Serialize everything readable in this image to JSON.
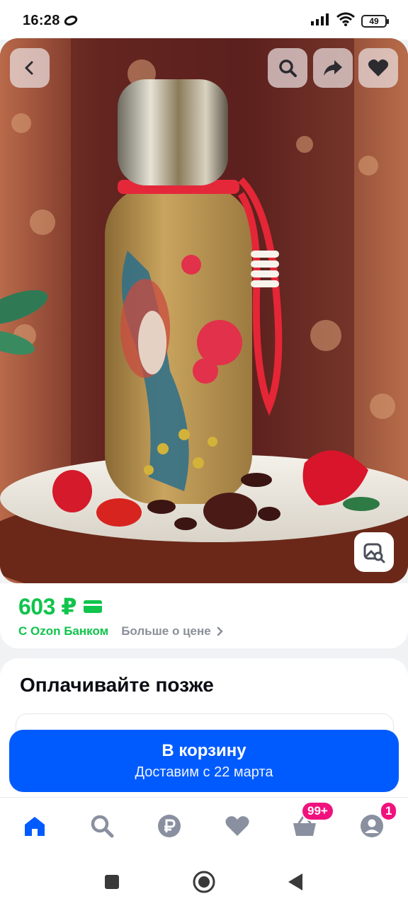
{
  "status_bar": {
    "time": "16:28",
    "battery": "49",
    "icons": [
      "moon-icon",
      "signal-icon",
      "wifi-icon",
      "battery-icon"
    ]
  },
  "product": {
    "image_buttons": [
      "back-icon",
      "search-icon",
      "share-icon",
      "heart-icon",
      "image-search-icon"
    ]
  },
  "price": {
    "value": "603 ₽",
    "bank_label": "С Ozon Банком",
    "more_link": "Больше о цене",
    "accent_color": "#10c44c"
  },
  "pay_later": {
    "title": "Оплачивайте позже"
  },
  "cart_button": {
    "label": "В корзину",
    "delivery": "Доставим с 22 марта",
    "color": "#005bff"
  },
  "bottom_nav": {
    "items": [
      {
        "icon": "home-icon",
        "active": true
      },
      {
        "icon": "search-icon",
        "active": false
      },
      {
        "icon": "ruble-icon",
        "active": false
      },
      {
        "icon": "heart-icon",
        "active": false
      },
      {
        "icon": "cart-icon",
        "active": false
      },
      {
        "icon": "profile-icon",
        "active": false
      }
    ],
    "cart_badge": "99+",
    "profile_badge": "1",
    "badge_color": "#f1117e"
  },
  "system_nav": {
    "buttons": [
      "recents-icon",
      "home-circle-icon",
      "back-triangle-icon"
    ]
  }
}
